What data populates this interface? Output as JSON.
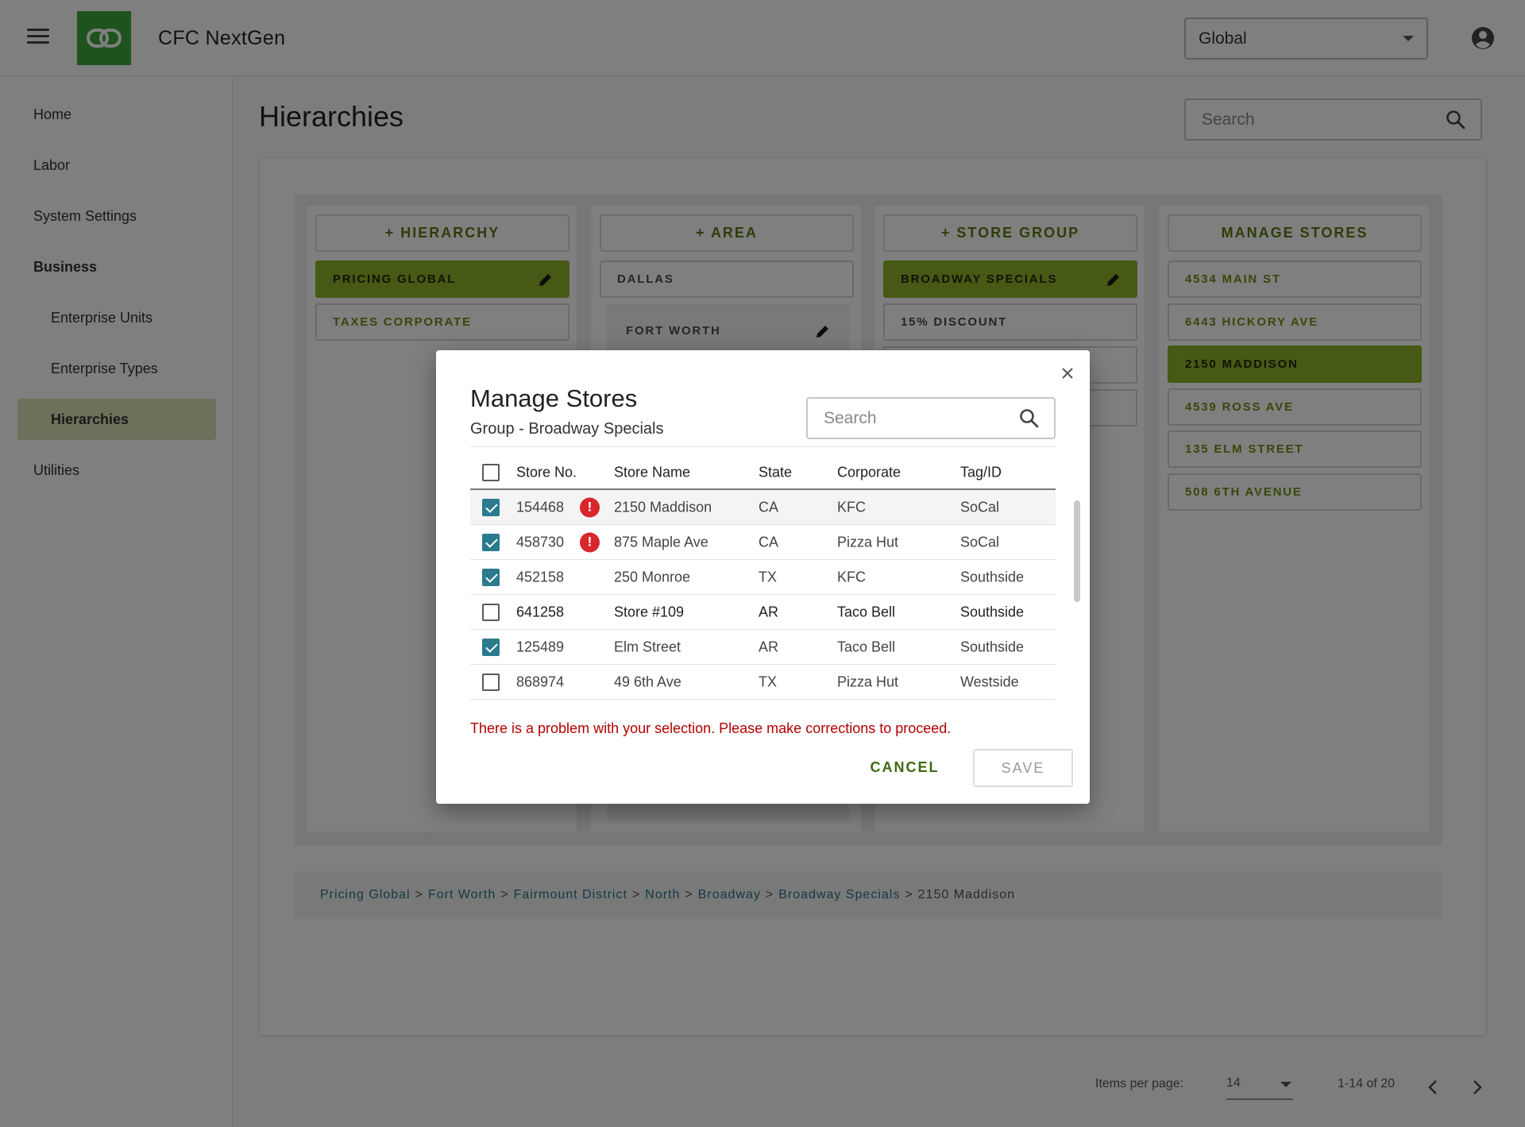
{
  "app": {
    "title": "CFC NextGen",
    "scope": "Global"
  },
  "sidebar": {
    "items": [
      "Home",
      "Labor",
      "System Settings",
      "Business",
      "Enterprise Units",
      "Enterprise Types",
      "Hierarchies",
      "Utilities"
    ]
  },
  "page": {
    "title": "Hierarchies",
    "search_placeholder": "Search"
  },
  "columns": {
    "hierarchy": {
      "button": "+ HIERARCHY",
      "items": [
        "PRICING GLOBAL",
        "TAXES CORPORATE"
      ]
    },
    "area": {
      "button": "+ AREA",
      "items": [
        "DALLAS",
        "FORT WORTH"
      ]
    },
    "store_group": {
      "button": "+ STORE GROUP",
      "items": [
        "BROADWAY SPECIALS",
        "15% DISCOUNT"
      ]
    },
    "stores": {
      "button": "MANAGE STORES",
      "items": [
        "4534 MAIN ST",
        "6443 HICKORY AVE",
        "2150 MADDISON",
        "4539 ROSS AVE",
        "135 ELM STREET",
        "508 6TH AVENUE"
      ]
    }
  },
  "breadcrumb": {
    "links": [
      "Pricing Global",
      "Fort Worth",
      "Fairmount District",
      "North",
      "Broadway",
      "Broadway Specials"
    ],
    "current": "2150 Maddison",
    "separator": ">"
  },
  "pagination": {
    "label": "Items per page:",
    "per_page": "14",
    "range": "1-14 of 20"
  },
  "dialog": {
    "title": "Manage Stores",
    "subtitle": "Group - Broadway Specials",
    "search_placeholder": "Search",
    "columns": [
      "Store No.",
      "Store Name",
      "State",
      "Corporate",
      "Tag/ID"
    ],
    "rows": [
      {
        "store_no": "154468",
        "name": "2150 Maddison",
        "state": "CA",
        "corporate": "KFC",
        "tag": "SoCal",
        "checked": true,
        "error": true
      },
      {
        "store_no": "458730",
        "name": "875 Maple Ave",
        "state": "CA",
        "corporate": "Pizza Hut",
        "tag": "SoCal",
        "checked": true,
        "error": true
      },
      {
        "store_no": "452158",
        "name": "250 Monroe",
        "state": "TX",
        "corporate": "KFC",
        "tag": "Southside",
        "checked": true,
        "error": false
      },
      {
        "store_no": "641258",
        "name": "Store #109",
        "state": "AR",
        "corporate": "Taco Bell",
        "tag": "Southside",
        "checked": false,
        "error": false
      },
      {
        "store_no": "125489",
        "name": "Elm Street",
        "state": "AR",
        "corporate": "Taco Bell",
        "tag": "Southside",
        "checked": true,
        "error": false
      },
      {
        "store_no": "868974",
        "name": "49 6th Ave",
        "state": "TX",
        "corporate": "Pizza Hut",
        "tag": "Westside",
        "checked": false,
        "error": false
      }
    ],
    "error_icon_glyph": "!",
    "error_message": "There is a problem with your selection. Please make corrections to proceed.",
    "cancel_label": "CANCEL",
    "save_label": "SAVE"
  },
  "colors": {
    "accent_green": "#8cb22a",
    "brand_green": "#3aa63a",
    "checkbox_teal": "#2b7a8e",
    "error_red": "#d9262c"
  }
}
